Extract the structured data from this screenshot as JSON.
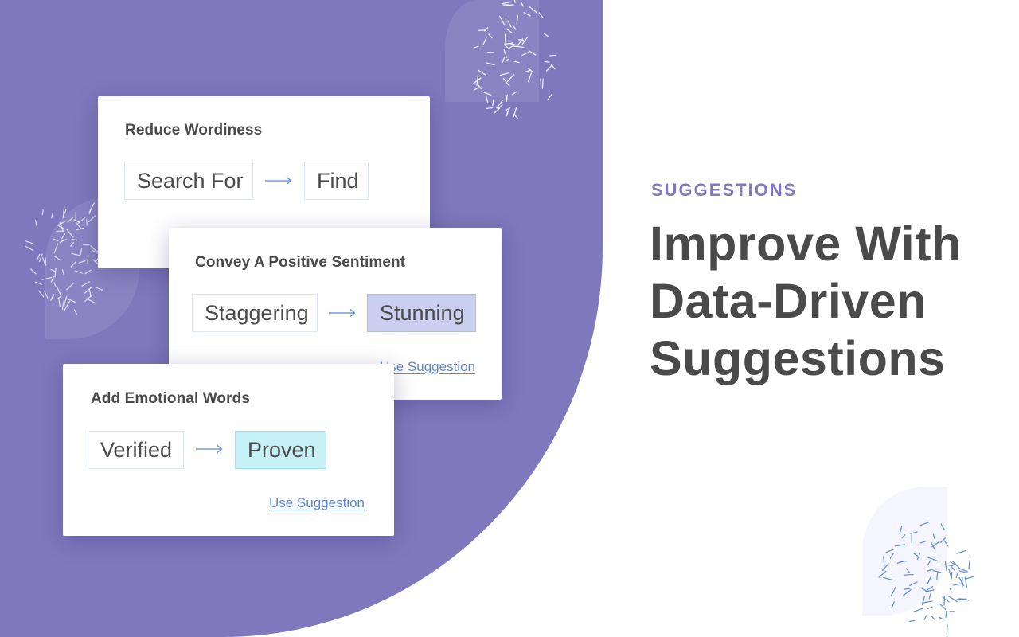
{
  "colors": {
    "background_purple": "#7f78bd",
    "accent_purple": "#8078bf",
    "link_blue": "#5b86d6",
    "highlight_purple": "#cbd0f0",
    "highlight_cyan": "#c5f0f5",
    "text_dark": "#4a4a4a"
  },
  "cards": [
    {
      "title": "Reduce Wordiness",
      "from": "Search For",
      "arrow_icon": "arrow-right-icon",
      "to": "Find",
      "to_style": "plain",
      "action": ""
    },
    {
      "title": "Convey A Positive Sentiment",
      "from": "Staggering",
      "arrow_icon": "arrow-right-icon",
      "to": "Stunning",
      "to_style": "highlight-purple",
      "action": "Use Suggestion"
    },
    {
      "title": "Add Emotional Words",
      "from": "Verified",
      "arrow_icon": "arrow-right-icon",
      "to": "Proven",
      "to_style": "highlight-cyan",
      "action": "Use Suggestion"
    }
  ],
  "hero": {
    "eyebrow": "SUGGESTIONS",
    "headline_lines": [
      "Improve With",
      "Data-Driven",
      "Suggestions"
    ]
  }
}
